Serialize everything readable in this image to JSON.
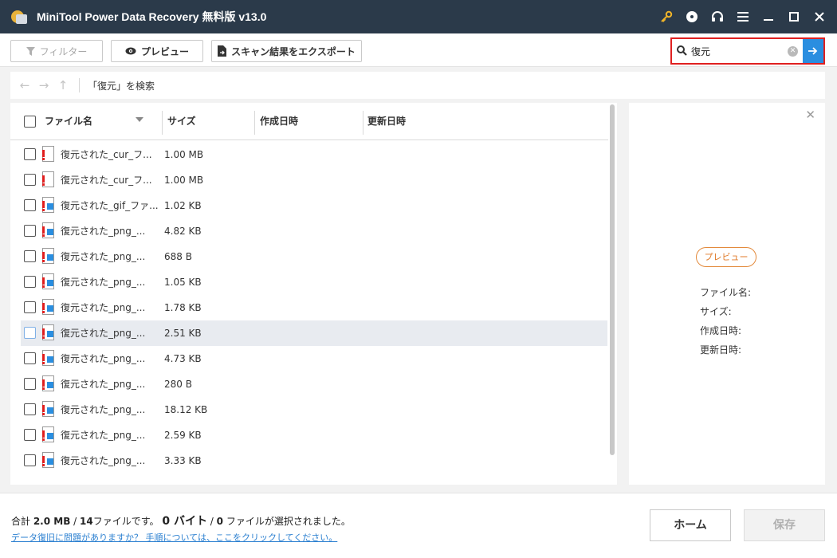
{
  "window": {
    "title": "MiniTool Power Data Recovery 無料版 v13.0",
    "icons": [
      "key-icon",
      "disc-icon",
      "headphones-icon",
      "menu-icon",
      "minimize-icon",
      "maximize-icon",
      "close-icon"
    ],
    "accent": "#2a8ee0",
    "titlebar_color": "#2b3a4a"
  },
  "toolbar": {
    "filter_label": "フィルター",
    "preview_label": "プレビュー",
    "export_label": "スキャン結果をエクスポート"
  },
  "search": {
    "value": "復元",
    "highlight_color": "#e02020"
  },
  "pathbar": {
    "path": "「復元」を検索"
  },
  "table": {
    "columns": [
      "ファイル名",
      "サイズ",
      "作成日時",
      "更新日時"
    ],
    "rows": [
      {
        "name": "復元された_cur_フ...",
        "size": "1.00 MB",
        "type": "cur"
      },
      {
        "name": "復元された_cur_フ...",
        "size": "1.00 MB",
        "type": "cur"
      },
      {
        "name": "復元された_gif_ファ...",
        "size": "1.02 KB",
        "type": "img"
      },
      {
        "name": "復元された_png_...",
        "size": "4.82 KB",
        "type": "img"
      },
      {
        "name": "復元された_png_...",
        "size": "688 B",
        "type": "img"
      },
      {
        "name": "復元された_png_...",
        "size": "1.05 KB",
        "type": "img"
      },
      {
        "name": "復元された_png_...",
        "size": "1.78 KB",
        "type": "img"
      },
      {
        "name": "復元された_png_...",
        "size": "2.51 KB",
        "type": "img",
        "highlighted": true
      },
      {
        "name": "復元された_png_...",
        "size": "4.73 KB",
        "type": "img"
      },
      {
        "name": "復元された_png_...",
        "size": "280 B",
        "type": "img"
      },
      {
        "name": "復元された_png_...",
        "size": "18.12 KB",
        "type": "img"
      },
      {
        "name": "復元された_png_...",
        "size": "2.59 KB",
        "type": "img"
      },
      {
        "name": "復元された_png_...",
        "size": "3.33 KB",
        "type": "img"
      }
    ]
  },
  "preview": {
    "button_label": "プレビュー",
    "filename_label": "ファイル名:",
    "size_label": "サイズ:",
    "created_label": "作成日時:",
    "modified_label": "更新日時:"
  },
  "footer": {
    "total_prefix": "合計 ",
    "total_size": "2.0 MB",
    "sep": " / ",
    "total_files": "14",
    "files_suffix": "ファイルです。 ",
    "selected_size": "0 バイト",
    "sep2": " / ",
    "selected_count": "0",
    "selected_suffix": " ファイルが選択されました。",
    "help_link": "データ復旧に問題がありますか？ 手順については、ここをクリックしてください。",
    "home_label": "ホーム",
    "save_label": "保存"
  }
}
